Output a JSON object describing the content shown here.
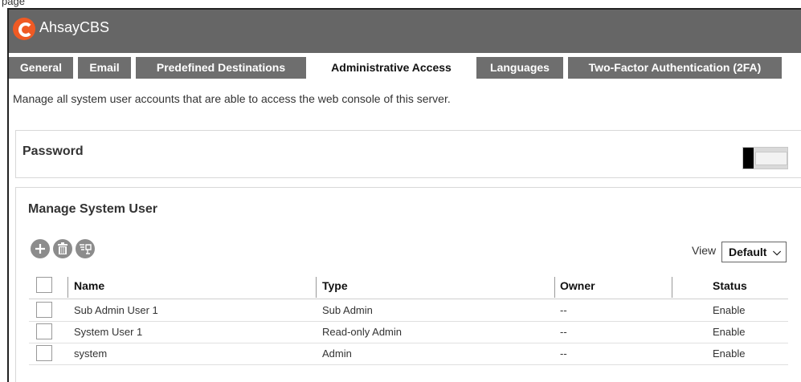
{
  "top_caption": "page",
  "app": {
    "title": "AhsayCBS",
    "accent": "#ef5a24",
    "header_bg": "#666666"
  },
  "tabs": [
    {
      "label": "General",
      "active": false
    },
    {
      "label": "Email",
      "active": false
    },
    {
      "label": "Predefined Destinations",
      "active": false
    },
    {
      "label": "Administrative Access",
      "active": true
    },
    {
      "label": "Languages",
      "active": false
    },
    {
      "label": "Two-Factor Authentication (2FA)",
      "active": false
    }
  ],
  "intro": "Manage all system user accounts that are able to access the web console of this server.",
  "password": {
    "title": "Password",
    "toggle_on": false
  },
  "manage": {
    "title": "Manage System User",
    "toolbar": [
      "add-icon",
      "delete-icon",
      "assign-icon"
    ],
    "view_label": "View",
    "view_value": "Default",
    "columns": [
      "Name",
      "Type",
      "Owner",
      "Status"
    ],
    "rows": [
      {
        "name": "Sub Admin User 1",
        "type": "Sub Admin",
        "owner": "--",
        "status": "Enable"
      },
      {
        "name": "System User 1",
        "type": "Read-only Admin",
        "owner": "--",
        "status": "Enable"
      },
      {
        "name": "system",
        "type": "Admin",
        "owner": "--",
        "status": "Enable"
      }
    ]
  }
}
